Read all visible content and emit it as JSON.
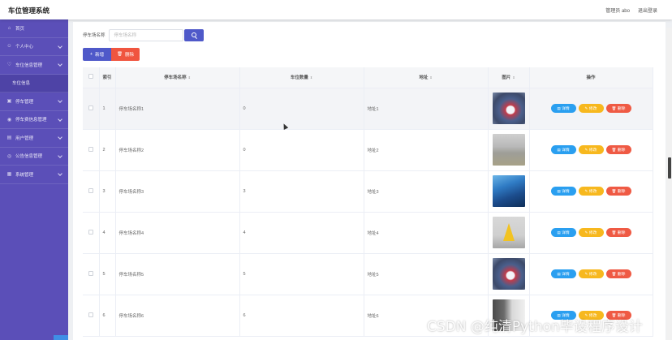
{
  "app": {
    "title": "车位管理系统"
  },
  "header": {
    "user_label": "管理员 abo",
    "logout_label": "退出登录"
  },
  "sidebar": {
    "items": [
      {
        "label": "首页",
        "icon": "home-icon",
        "has_children": false
      },
      {
        "label": "个人中心",
        "icon": "user-icon",
        "has_children": true
      },
      {
        "label": "车位信息管理",
        "icon": "parking-icon",
        "has_children": true
      },
      {
        "label": "车位信息",
        "icon": "",
        "has_children": false,
        "sub": true
      },
      {
        "label": "停车管理",
        "icon": "car-icon",
        "has_children": true
      },
      {
        "label": "停车费信息管理",
        "icon": "fee-icon",
        "has_children": true
      },
      {
        "label": "用户管理",
        "icon": "users-icon",
        "has_children": true
      },
      {
        "label": "公告信息管理",
        "icon": "notice-icon",
        "has_children": true
      },
      {
        "label": "系统管理",
        "icon": "settings-icon",
        "has_children": true
      }
    ]
  },
  "search": {
    "label": "停车场名称",
    "placeholder": "停车场名称"
  },
  "actions": {
    "add_label": "新增",
    "delete_label": "删除"
  },
  "table": {
    "columns": [
      "索引",
      "停车场名称",
      "车位数量",
      "地址",
      "图片",
      "操作"
    ],
    "rows": [
      {
        "index": "1",
        "name": "停车场名称1",
        "count": "0",
        "address": "地址1",
        "image": "t1"
      },
      {
        "index": "2",
        "name": "停车场名称2",
        "count": "0",
        "address": "地址2",
        "image": "t2"
      },
      {
        "index": "3",
        "name": "停车场名称3",
        "count": "3",
        "address": "地址3",
        "image": "t3"
      },
      {
        "index": "4",
        "name": "停车场名称4",
        "count": "4",
        "address": "地址4",
        "image": "t4"
      },
      {
        "index": "5",
        "name": "停车场名称5",
        "count": "5",
        "address": "地址5",
        "image": "t1"
      },
      {
        "index": "6",
        "name": "停车场名称6",
        "count": "6",
        "address": "地址6",
        "image": "t6"
      }
    ],
    "row_actions": {
      "detail": "详情",
      "edit": "修改",
      "delete": "删除"
    }
  },
  "watermark": "CSDN @纯清Python毕设程序设计",
  "colors": {
    "sidebar": "#5b4fb8",
    "primary": "#4f59c9",
    "danger": "#f0553f",
    "info": "#2a9ff0",
    "warning": "#f7b81e"
  }
}
